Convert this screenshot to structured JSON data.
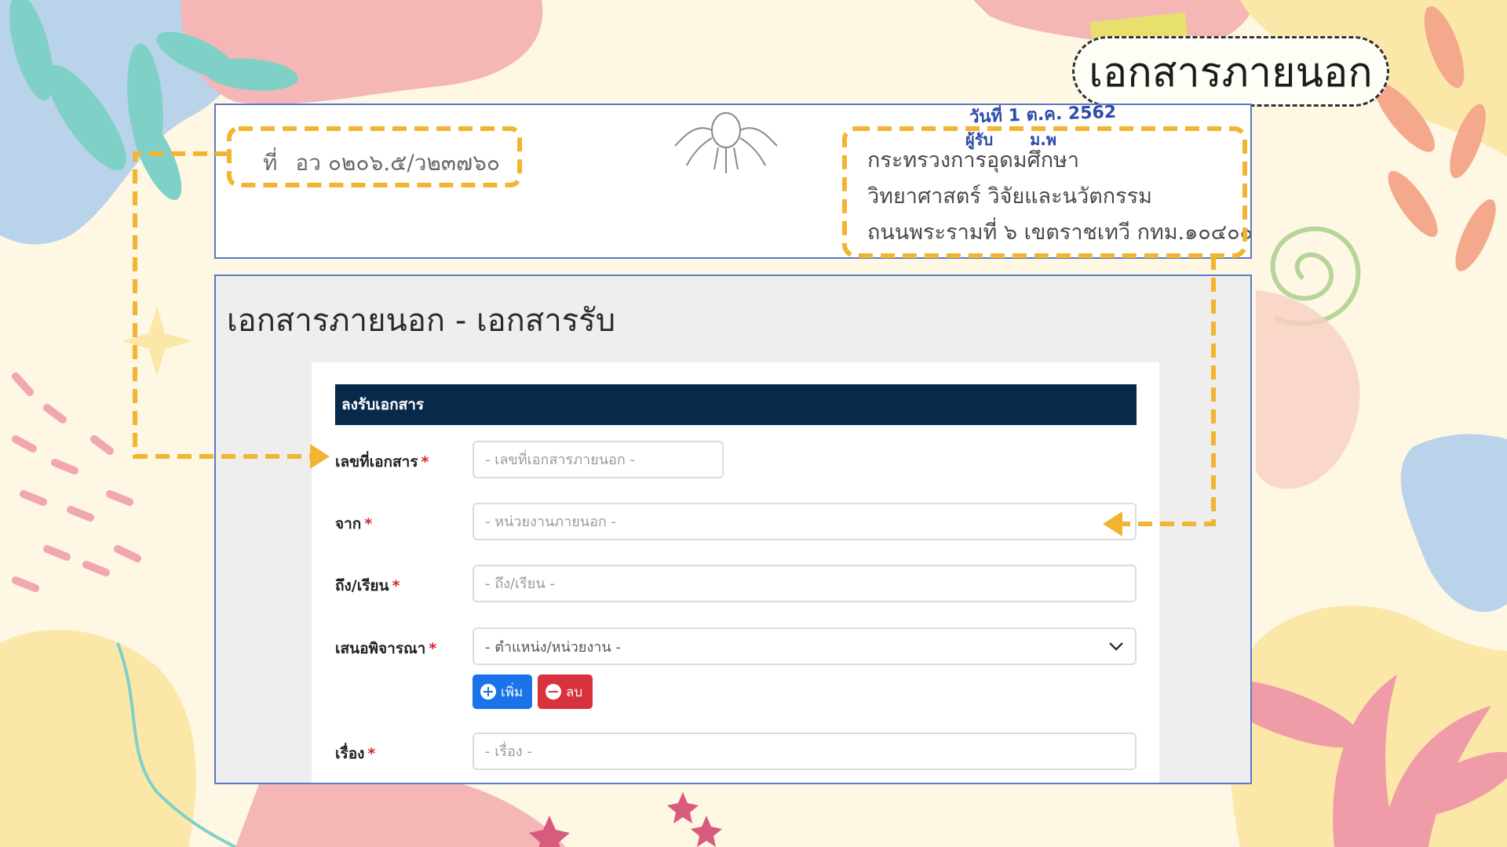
{
  "slide": {
    "title": "เอกสารภายนอก"
  },
  "document": {
    "ref_label": "ที่",
    "ref_number": "อว ๐๒๐๖.๕/ว๒๓๗๖๐",
    "address": [
      "กระทรวงการอุดมศึกษา",
      "วิทยาศาสตร์ วิจัยและนวัตกรรม",
      "ถนนพระรามที่ ๖ เขตราชเทวี กทม.๑๐๔๐๐"
    ],
    "stamp_line1": "วันที่ 1 ต.ค. 2562",
    "stamp_line2": "ผู้รับ",
    "stamp_line3": "ม.พ"
  },
  "form": {
    "page_title": "เอกสารภายนอก - เอกสารรับ",
    "card_title": "ลงรับเอกสาร",
    "fields": {
      "doc_number": {
        "label": "เลขที่เอกสาร",
        "required": "*",
        "placeholder": "- เลขที่เอกสารภายนอก -"
      },
      "from": {
        "label": "จาก",
        "required": "*",
        "placeholder": "- หน่วยงานภายนอก -"
      },
      "to": {
        "label": "ถึง/เรียน",
        "required": "*",
        "placeholder": "- ถึง/เรียน -"
      },
      "propose": {
        "label": "เสนอพิจารณา",
        "required": "*",
        "selected": "- ตำแหน่ง/หน่วยงาน -"
      },
      "subject": {
        "label": "เรื่อง",
        "required": "*",
        "placeholder": "- เรื่อง -"
      }
    },
    "buttons": {
      "add": "เพิ่ม",
      "delete": "ลบ"
    }
  },
  "colors": {
    "annotation": "#f2b531",
    "header_bar": "#082a4a",
    "add_button": "#1a73e8",
    "delete_button": "#d9323f",
    "required_star": "#d9232d"
  }
}
